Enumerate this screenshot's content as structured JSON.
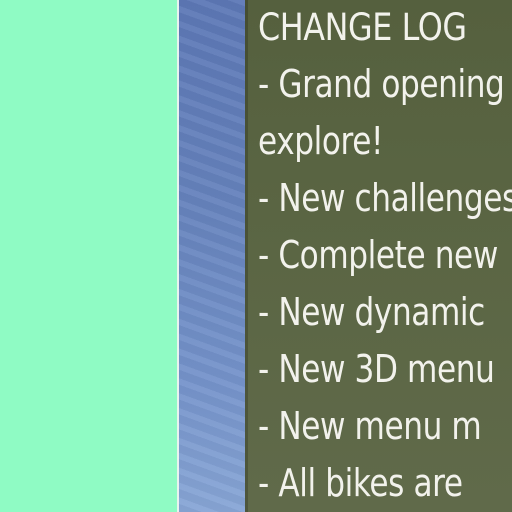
{
  "changelog": {
    "title": "CHANGE LOG",
    "lines": [
      "- Grand opening",
      "explore!",
      "- New challenges",
      "- Complete new",
      "- New dynamic",
      "- New 3D menu",
      "- New menu m",
      "- All bikes are"
    ]
  },
  "colors": {
    "left_panel": "#8ffbc4",
    "changelog_background": "#5a6543",
    "changelog_text": "#f2f2ec",
    "sky": "#6683bd"
  }
}
